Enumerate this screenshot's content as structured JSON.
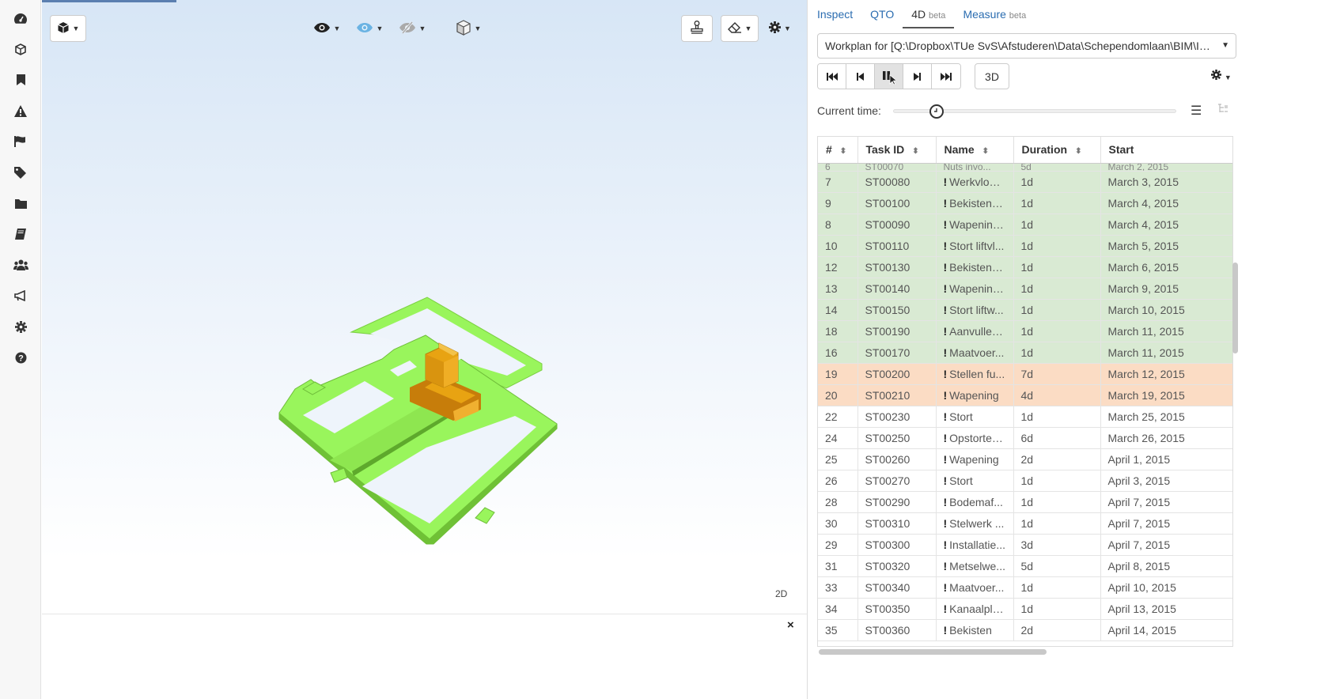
{
  "viewer": {
    "label_2d": "2D",
    "close_symbol": "×",
    "toolbar": {
      "cube_icon": "cube-icon",
      "eye_icon": "eye-icon",
      "eye_blue_icon": "eye-icon",
      "eye_slash_icon": "eye-slash-icon",
      "box_icon": "box-icon",
      "stamp_icon": "stamp-icon",
      "eraser_icon": "eraser-icon",
      "gear_icon": "gear-icon"
    },
    "colors": {
      "model_green": "#99f55c",
      "model_orange": "#e8a312"
    }
  },
  "sidebar": {
    "icons": [
      "dashboard-icon",
      "cube-icon",
      "bookmark-icon",
      "warning-icon",
      "flag-icon",
      "tags-icon",
      "folder-icon",
      "book-icon",
      "users-icon",
      "megaphone-icon",
      "gear-icon",
      "help-icon"
    ]
  },
  "panel": {
    "tabs": [
      {
        "label": "Inspect",
        "beta": ""
      },
      {
        "label": "QTO",
        "beta": ""
      },
      {
        "label": "4D",
        "beta": "beta"
      },
      {
        "label": "Measure",
        "beta": "beta"
      }
    ],
    "workplan_value": "Workplan for [Q:\\Dropbox\\TUe SvS\\Afstuderen\\Data\\Schependomlaan\\BIM\\IF...",
    "player": {
      "first": "⏮",
      "prev": "⏴",
      "pause": "⏸",
      "next": "⏵",
      "last": "⏭",
      "mode_3d": "3D"
    },
    "current_time_label": "Current time:",
    "slider_position": 0.15,
    "table": {
      "headers": {
        "num": "#",
        "task": "Task ID",
        "name": "Name",
        "duration": "Duration",
        "start": "Start"
      },
      "partial_row": {
        "num": "6",
        "task": "ST00070",
        "name": "Nuts invo...",
        "duration": "5d",
        "start": "March 2, 2015"
      },
      "rows": [
        {
          "num": "7",
          "task": "ST00080",
          "name": "Werkvloer...",
          "duration": "1d",
          "start": "March 3, 2015",
          "status": "done"
        },
        {
          "num": "9",
          "task": "ST00100",
          "name": "Bekisten l...",
          "duration": "1d",
          "start": "March 4, 2015",
          "status": "done"
        },
        {
          "num": "8",
          "task": "ST00090",
          "name": "Wapening...",
          "duration": "1d",
          "start": "March 4, 2015",
          "status": "done"
        },
        {
          "num": "10",
          "task": "ST00110",
          "name": "Stort liftvl...",
          "duration": "1d",
          "start": "March 5, 2015",
          "status": "done"
        },
        {
          "num": "12",
          "task": "ST00130",
          "name": "Bekisten l...",
          "duration": "1d",
          "start": "March 6, 2015",
          "status": "done"
        },
        {
          "num": "13",
          "task": "ST00140",
          "name": "Wapening...",
          "duration": "1d",
          "start": "March 9, 2015",
          "status": "done"
        },
        {
          "num": "14",
          "task": "ST00150",
          "name": "Stort liftw...",
          "duration": "1d",
          "start": "March 10, 2015",
          "status": "done"
        },
        {
          "num": "18",
          "task": "ST00190",
          "name": "Aanvullen...",
          "duration": "1d",
          "start": "March 11, 2015",
          "status": "done"
        },
        {
          "num": "16",
          "task": "ST00170",
          "name": "Maatvoer...",
          "duration": "1d",
          "start": "March 11, 2015",
          "status": "done"
        },
        {
          "num": "19",
          "task": "ST00200",
          "name": "Stellen fu...",
          "duration": "7d",
          "start": "March 12, 2015",
          "status": "active"
        },
        {
          "num": "20",
          "task": "ST00210",
          "name": "Wapening",
          "duration": "4d",
          "start": "March 19, 2015",
          "status": "active"
        },
        {
          "num": "22",
          "task": "ST00230",
          "name": "Stort",
          "duration": "1d",
          "start": "March 25, 2015",
          "status": ""
        },
        {
          "num": "24",
          "task": "ST00250",
          "name": "Opstorten...",
          "duration": "6d",
          "start": "March 26, 2015",
          "status": ""
        },
        {
          "num": "25",
          "task": "ST00260",
          "name": "Wapening",
          "duration": "2d",
          "start": "April 1, 2015",
          "status": ""
        },
        {
          "num": "26",
          "task": "ST00270",
          "name": "Stort",
          "duration": "1d",
          "start": "April 3, 2015",
          "status": ""
        },
        {
          "num": "28",
          "task": "ST00290",
          "name": "Bodemaf...",
          "duration": "1d",
          "start": "April 7, 2015",
          "status": ""
        },
        {
          "num": "30",
          "task": "ST00310",
          "name": "Stelwerk ...",
          "duration": "1d",
          "start": "April 7, 2015",
          "status": ""
        },
        {
          "num": "29",
          "task": "ST00300",
          "name": "Installatie...",
          "duration": "3d",
          "start": "April 7, 2015",
          "status": ""
        },
        {
          "num": "31",
          "task": "ST00320",
          "name": "Metselwe...",
          "duration": "5d",
          "start": "April 8, 2015",
          "status": ""
        },
        {
          "num": "33",
          "task": "ST00340",
          "name": "Maatvoer...",
          "duration": "1d",
          "start": "April 10, 2015",
          "status": ""
        },
        {
          "num": "34",
          "task": "ST00350",
          "name": "Kanaalpla...",
          "duration": "1d",
          "start": "April 13, 2015",
          "status": ""
        },
        {
          "num": "35",
          "task": "ST00360",
          "name": "Bekisten",
          "duration": "2d",
          "start": "April 14, 2015",
          "status": ""
        }
      ]
    },
    "colors": {
      "done_row": "#d9ead3",
      "active_row": "#fbdcc4",
      "link": "#2a6cb0"
    }
  }
}
